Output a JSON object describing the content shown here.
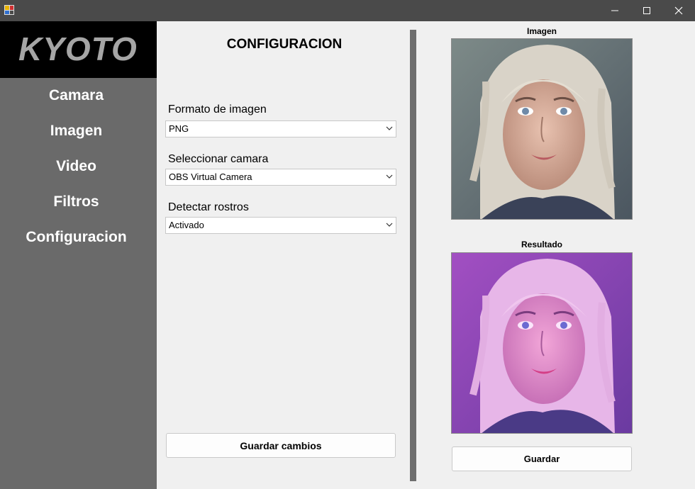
{
  "window": {
    "title_icon": "app-icon",
    "controls": [
      "minimize-icon",
      "maximize-icon",
      "close-icon"
    ]
  },
  "sidebar": {
    "logo": "KYOTO",
    "items": [
      {
        "label": "Camara"
      },
      {
        "label": "Imagen"
      },
      {
        "label": "Video"
      },
      {
        "label": "Filtros"
      },
      {
        "label": "Configuracion"
      }
    ]
  },
  "config": {
    "title": "CONFIGURACION",
    "format": {
      "label": "Formato de imagen",
      "value": "PNG"
    },
    "camera": {
      "label": "Seleccionar camara",
      "value": "OBS Virtual Camera"
    },
    "faces": {
      "label": "Detectar rostros",
      "value": "Activado"
    },
    "save_label": "Guardar cambios"
  },
  "preview": {
    "original_caption": "Imagen",
    "result_caption": "Resultado",
    "save_label": "Guardar"
  },
  "colors": {
    "sidebar_bg": "#6a6a6a",
    "titlebar_bg": "#4a4a4a",
    "logo_text": "#a5a5a5",
    "result_tint": "#c04ad8"
  }
}
